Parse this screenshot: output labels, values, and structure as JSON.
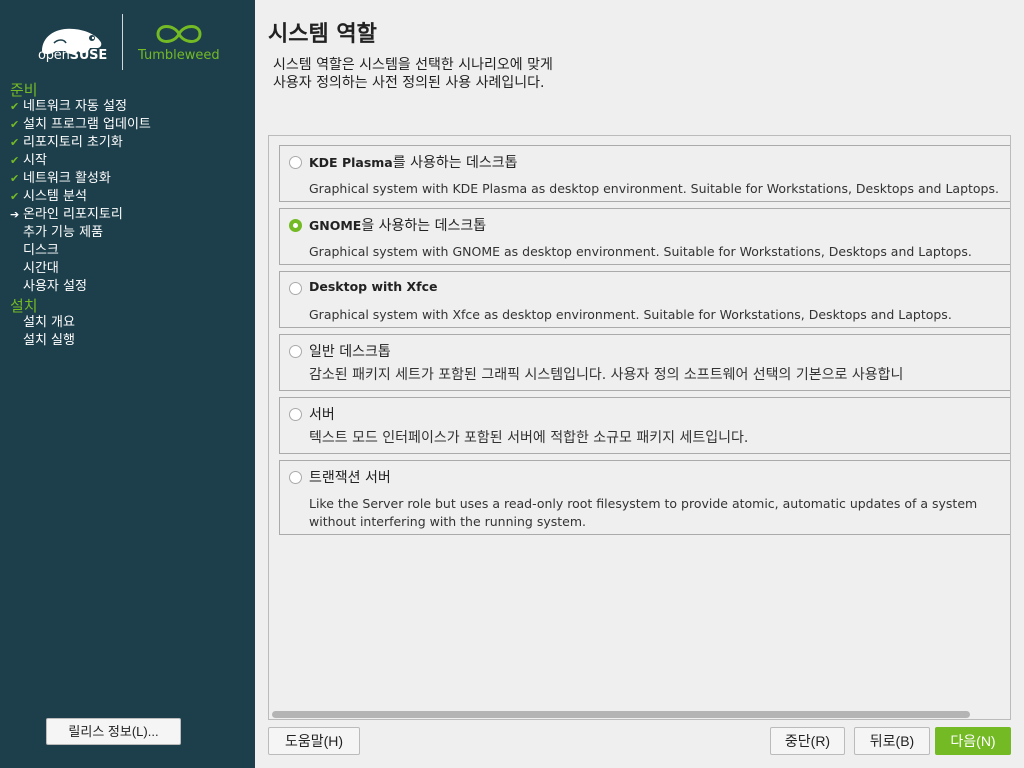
{
  "brand": {
    "opensuse_light": "open",
    "opensuse_bold": "SUSE",
    "tumbleweed": "Tumbleweed"
  },
  "sidebar": {
    "group_prepare": "준비",
    "group_install": "설치",
    "steps_prepare": [
      {
        "label": "네트워크 자동 설정",
        "status": "done"
      },
      {
        "label": "설치 프로그램 업데이트",
        "status": "done"
      },
      {
        "label": "리포지토리 초기화",
        "status": "done"
      },
      {
        "label": "시작",
        "status": "done"
      },
      {
        "label": "네트워크 활성화",
        "status": "done"
      },
      {
        "label": "시스템 분석",
        "status": "done"
      },
      {
        "label": "온라인 리포지토리",
        "status": "current"
      },
      {
        "label": "추가 기능 제품",
        "status": "pending"
      },
      {
        "label": "디스크",
        "status": "pending"
      },
      {
        "label": "시간대",
        "status": "pending"
      },
      {
        "label": "사용자 설정",
        "status": "pending"
      }
    ],
    "steps_install": [
      {
        "label": "설치 개요",
        "status": "pending"
      },
      {
        "label": "설치 실행",
        "status": "pending"
      }
    ],
    "release_notes_button": "릴리스 정보(L)..."
  },
  "main": {
    "title": "시스템 역할",
    "description_line1": "시스템 역할은 시스템을 선택한 시나리오에 맞게",
    "description_line2": "사용자 정의하는 사전 정의된 사용 사례입니다.",
    "roles": [
      {
        "title_bold": "KDE Plasma",
        "title_rest": "를 사용하는 데스크톱",
        "description": "Graphical system with KDE Plasma as desktop environment. Suitable for Workstations, Desktops and Laptops.",
        "selected": false
      },
      {
        "title_bold": "GNOME",
        "title_rest": "을 사용하는 데스크톱",
        "description": "Graphical system with GNOME as desktop environment. Suitable for Workstations, Desktops and Laptops.",
        "selected": true
      },
      {
        "title_bold": "Desktop with Xfce",
        "title_rest": "",
        "description": "Graphical system with Xfce as desktop environment. Suitable for Workstations, Desktops and Laptops.",
        "selected": false
      },
      {
        "title_bold": "",
        "title_rest": "일반 데스크톱",
        "description": "감소된 패키지 세트가 포함된 그래픽 시스템입니다. 사용자 정의 소프트웨어 선택의 기본으로 사용합니",
        "selected": false
      },
      {
        "title_bold": "",
        "title_rest": "서버",
        "description": "텍스트 모드 인터페이스가 포함된 서버에 적합한 소규모 패키지 세트입니다.",
        "selected": false
      },
      {
        "title_bold": "",
        "title_rest": "트랜잭션 서버",
        "description": "Like the Server role but uses a read-only root filesystem to provide atomic, automatic updates of a system",
        "description2": "without interfering with the running system.",
        "selected": false
      }
    ]
  },
  "buttons": {
    "help": "도움말(H)",
    "abort": "중단(R)",
    "back": "뒤로(B)",
    "next": "다음(N)"
  },
  "colors": {
    "sidebar_bg": "#1d3e4b",
    "accent_green": "#73ba25",
    "background": "#efefef"
  }
}
